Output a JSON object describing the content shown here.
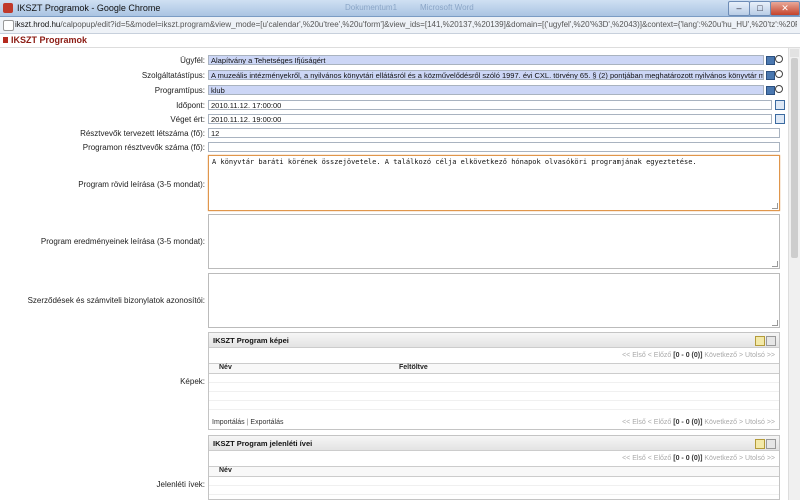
{
  "window": {
    "title": "IKSZT Programok - Google Chrome",
    "ghost_tabs": [
      "Dokumentum1",
      "Microsoft Word"
    ],
    "buttons": [
      "–",
      "□",
      "✕"
    ]
  },
  "browser": {
    "url_host": "ikszt.hrod.hu",
    "url_path": "/calpopup/edit?id=5&model=ikszt.program&view_mode=[u'calendar',%20u'tree',%20u'form']&view_ids=[141,%20137,%20139]&domain=[('ugyfel',%20'%3D',%2043)]&context={'lang':%20u'hu_HU',%20'tz':%20False,%20_ter"
  },
  "page": {
    "title": "IKSZT Programok"
  },
  "form": {
    "ugyfel": {
      "label": "Ügyfél:",
      "value": "Alapítvány a Tehetséges Ifjúságért"
    },
    "szolgaltatastipus": {
      "label": "Szolgáltatástípus:",
      "value": "A muzeális intézményekről, a nyilvános könyvtári ellátásról és a közművelődésről szóló 1997. évi CXL. törvény 65. § (2) pontjában meghatározott nyilvános könyvtár működtetése vagy"
    },
    "programtipus": {
      "label": "Programtípus:",
      "value": "klub"
    },
    "idopont": {
      "label": "Időpont:",
      "value": "2010.11.12. 17:00:00"
    },
    "veget_ert": {
      "label": "Véget ért:",
      "value": "2010.11.12. 19:00:00"
    },
    "tervezett_letszam": {
      "label": "Résztvevők tervezett létszáma (fő):",
      "value": "12"
    },
    "resztvevok_szama": {
      "label": "Programon résztvevők száma (fő):",
      "value": ""
    },
    "rovid_leiras": {
      "label": "Program rövid leírása (3-5 mondat):",
      "value": "A könyvtár baráti körének összejövetele. A találkozó célja elkövetkező hónapok olvasóköri programjának egyeztetése."
    },
    "eredmenyek": {
      "label": "Program eredményeinek leírása (3-5 mondat):",
      "value": ""
    },
    "szerzodesek": {
      "label": "Szerződések és számviteli bizonylatok azonosítói:",
      "value": ""
    },
    "kepek_label": "Képek:",
    "jelenleti_label": "Jelenléti ívek:"
  },
  "kepek_panel": {
    "title": "IKSZT Program képei",
    "pager_prefix": "<< Első < Előző ",
    "pager_count": "[0 - 0 (0)]",
    "pager_suffix": " Következő > Utolsó >>",
    "columns": [
      "Név",
      "Feltöltve"
    ],
    "import": "Importálás",
    "sep": "|",
    "export": "Exportálás"
  },
  "jelenleti_panel": {
    "title": "IKSZT Program jelenléti ívei",
    "pager_prefix": "<< Első < Előző ",
    "pager_count": "[0 - 0 (0)]",
    "pager_suffix": " Következő > Utolsó >>",
    "columns": [
      "Név"
    ]
  }
}
